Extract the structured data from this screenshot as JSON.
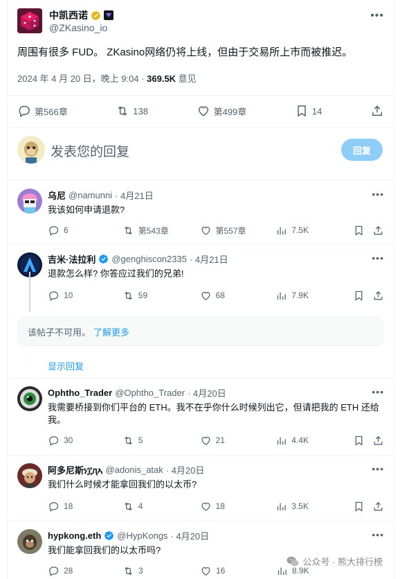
{
  "main_tweet": {
    "name": "中凯西诺",
    "handle": "@ZKasino_io",
    "text": "周围有很多 FUD。 ZKasino网络仍将上线，但由于交易所上市而被推迟。",
    "date": "2024 年 4 月 20 日，晚上 9:04 · ",
    "views": "369.5K",
    "views_label": " 意见",
    "stats": {
      "replies": "第566章",
      "retweets": "138",
      "likes": "第499章",
      "bookmarks": "14"
    }
  },
  "reply_composer": {
    "placeholder": "发表您的回复",
    "button": "回复"
  },
  "replies": [
    {
      "name": "乌尼",
      "handle": "@namunni",
      "date": "· 4月21日",
      "text": "我该如何申请退款?",
      "replies": "6",
      "retweets": "第543章",
      "likes": "第557章",
      "views": "7.5K"
    },
    {
      "name": "吉米·法拉利",
      "handle": "@genghiscon2335",
      "date": "· 4月21日",
      "text": "退款怎么样? 你答应过我们的兄弟!",
      "replies": "10",
      "retweets": "59",
      "likes": "68",
      "views": "7.9K"
    },
    {
      "name": "Ophtho_Trader",
      "handle": "@Ophtho_Trader",
      "date": "· 4月20日",
      "text": "我需要桥接到你们平台的 ETH。我不在乎你什么时候列出它，但请把我的 ETH 还给我。",
      "replies": "30",
      "retweets": "5",
      "likes": "21",
      "views": "4.4K"
    },
    {
      "name": "阿多尼斯ነ፲ԯኣ",
      "handle": "@adonis_atak",
      "date": "· 4月20日",
      "text": "我们什么时候才能拿回我们的以太币?",
      "replies": "18",
      "retweets": "4",
      "likes": "18",
      "views": "3.5K"
    },
    {
      "name": "hypkong.eth",
      "handle": "@HypKongs",
      "date": "· 4月20日",
      "text": "我们能拿回我们的以太币吗?",
      "replies": "28",
      "retweets": "3",
      "likes": "16",
      "views": "8.9K"
    }
  ],
  "unavailable": {
    "text": "该帖子不可用。",
    "link": "了解更多"
  },
  "show_replies": "显示回复",
  "watermark": "公众号 · 熊大排行榜",
  "colors": {
    "accent": "#1d9bf0",
    "muted": "#536471",
    "reply_button": "#8ecdf8"
  }
}
